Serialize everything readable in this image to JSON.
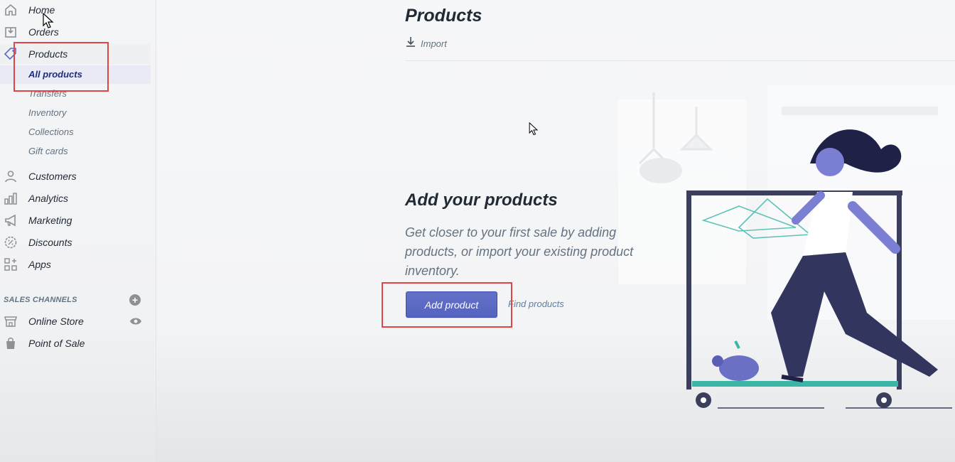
{
  "sidebar": {
    "items": [
      {
        "label": "Home",
        "icon": "home-icon"
      },
      {
        "label": "Orders",
        "icon": "orders-icon"
      },
      {
        "label": "Products",
        "icon": "tag-icon"
      },
      {
        "label": "Customers",
        "icon": "person-icon"
      },
      {
        "label": "Analytics",
        "icon": "bar-chart-icon"
      },
      {
        "label": "Marketing",
        "icon": "megaphone-icon"
      },
      {
        "label": "Discounts",
        "icon": "discount-icon"
      },
      {
        "label": "Apps",
        "icon": "apps-icon"
      }
    ],
    "product_subitems": [
      {
        "label": "All products",
        "active": true
      },
      {
        "label": "Transfers"
      },
      {
        "label": "Inventory"
      },
      {
        "label": "Collections"
      },
      {
        "label": "Gift cards"
      }
    ],
    "sales_channels": {
      "title": "SALES CHANNELS",
      "items": [
        {
          "label": "Online Store",
          "icon": "store-icon"
        },
        {
          "label": "Point of Sale",
          "icon": "pos-bag-icon"
        }
      ]
    }
  },
  "main": {
    "title": "Products",
    "import_label": "Import",
    "empty_state": {
      "heading": "Add your products",
      "text": "Get closer to your first sale by adding products, or import your existing product inventory.",
      "primary_action": "Add product",
      "secondary_action": "Find products"
    }
  },
  "colors": {
    "accent": "#5c6ac4",
    "highlight_box": "#e04444",
    "active_subitem_bg": "#e9eaf6"
  }
}
